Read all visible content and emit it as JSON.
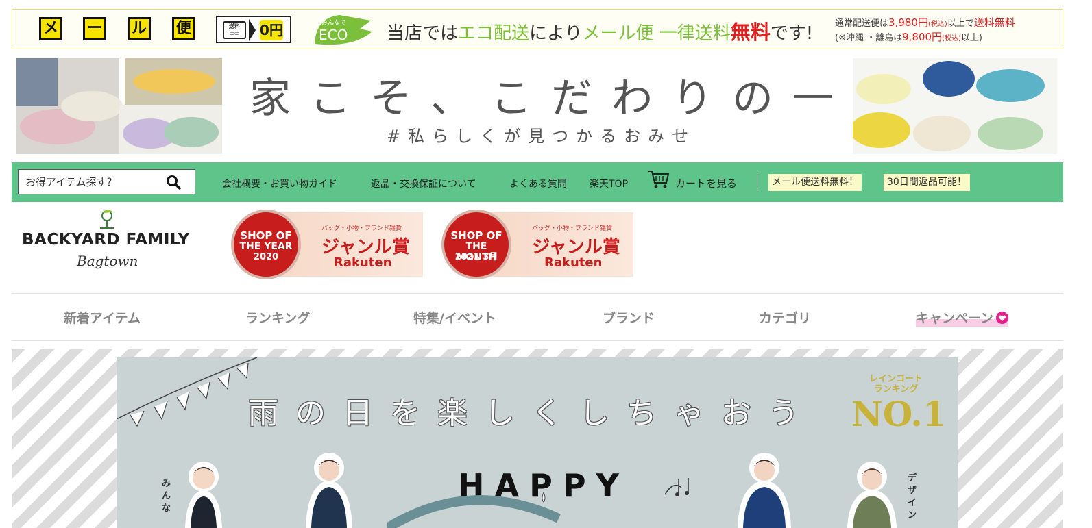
{
  "mail_banner": {
    "kana_chars": [
      "メ",
      "ー",
      "ル",
      "便"
    ],
    "truck_label": "送料",
    "zero_label": "0円",
    "eco_badge_top": "みんなで",
    "eco_badge_main": "ECO",
    "eco_text_prefix": "当店では",
    "eco_text_green1": "エコ配送",
    "eco_text_mid": "により",
    "eco_text_green2": "メール便 一律送料",
    "eco_text_red": "無料",
    "eco_text_suffix": "です!",
    "note_line1_prefix": "通常配送便は",
    "note_line1_amount": "3,980円",
    "note_line1_tax": "(税込)",
    "note_line1_mid": "以上で",
    "note_line1_red": "送料無料",
    "note_line2_prefix": "(※沖縄 ・離島は",
    "note_line2_amount": "9,800円",
    "note_line2_tax": "(税込)",
    "note_line2_suffix": "以上)"
  },
  "hero": {
    "title": "家こそ、こだわりの一足を",
    "subtitle": "#私らしくが見つかるおみせ"
  },
  "greenbar": {
    "search_placeholder": "お得アイテム探す？",
    "links": [
      "会社概要・お買い物ガイド",
      "返品・交換保証について",
      "よくある質問",
      "楽天TOP"
    ],
    "cart_label": "カートを見る",
    "promo_mail": "メール便送料無料！",
    "promo_return": "30日間返品可能！"
  },
  "logo": {
    "main": "BACKYARD FAMILY",
    "sub": "Bagtown"
  },
  "awards": [
    {
      "seal_l1": "SHOP OF",
      "seal_l2": "THE YEAR",
      "seal_l3": "2020",
      "caption": "バッグ・小物・ブランド雑貨",
      "genre": "ジャンル賞",
      "brand": "Rakuten"
    },
    {
      "seal_l1": "SHOP OF",
      "seal_l2": "THE MONTH",
      "seal_l3": "2021 3月",
      "caption": "バッグ・小物・ブランド雑貨",
      "genre": "ジャンル賞",
      "brand": "Rakuten"
    }
  ],
  "category_nav": [
    "新着アイテム",
    "ランキング",
    "特集/イベント",
    "ブランド",
    "カテゴリ",
    "キャンペーン"
  ],
  "rain_banner": {
    "title": "雨の日を楽しくしちゃおう",
    "ranking_line1": "レインコート",
    "ranking_line2": "ランキング",
    "ranking_no": "NO.1",
    "happy": "HAPPY",
    "side_left": "みんな",
    "side_right": "デザイン"
  },
  "colors": {
    "green_bar": "#5ec48a",
    "accent_red": "#e02020",
    "eco_green": "#7cbf3a",
    "kana_yellow": "#f6e400",
    "campaign_pink": "#e61e8c"
  }
}
